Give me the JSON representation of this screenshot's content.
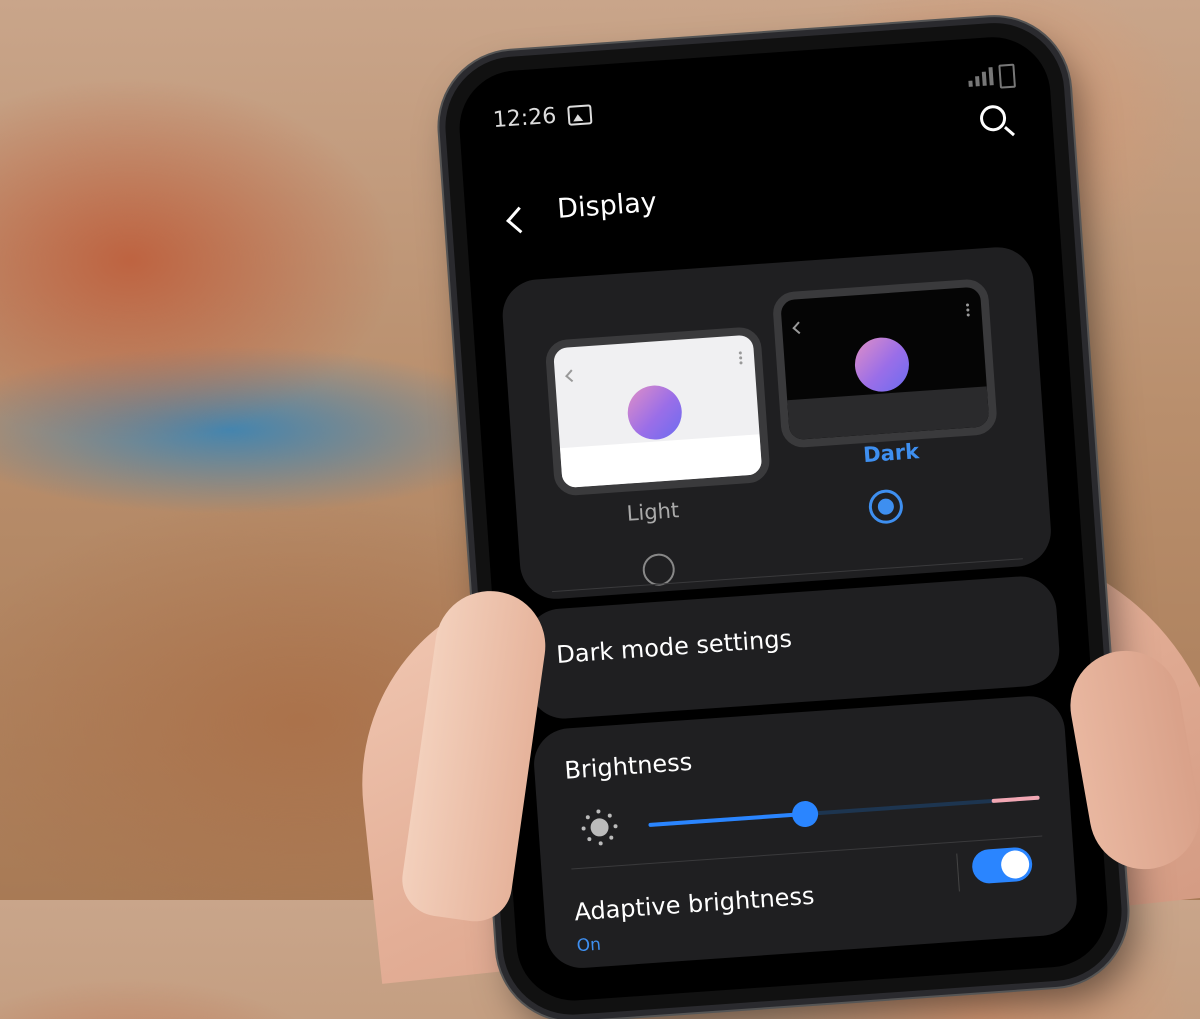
{
  "status_bar": {
    "time": "12:26"
  },
  "header": {
    "title": "Display"
  },
  "theme": {
    "light_label": "Light",
    "dark_label": "Dark",
    "selected": "Dark"
  },
  "dark_mode": {
    "label": "Dark mode settings"
  },
  "brightness": {
    "label": "Brightness",
    "level_fraction": 0.4
  },
  "adaptive": {
    "label": "Adaptive brightness",
    "status": "On",
    "enabled": true
  },
  "colors": {
    "accent": "#2a85ff",
    "card": "#1f1f21"
  }
}
